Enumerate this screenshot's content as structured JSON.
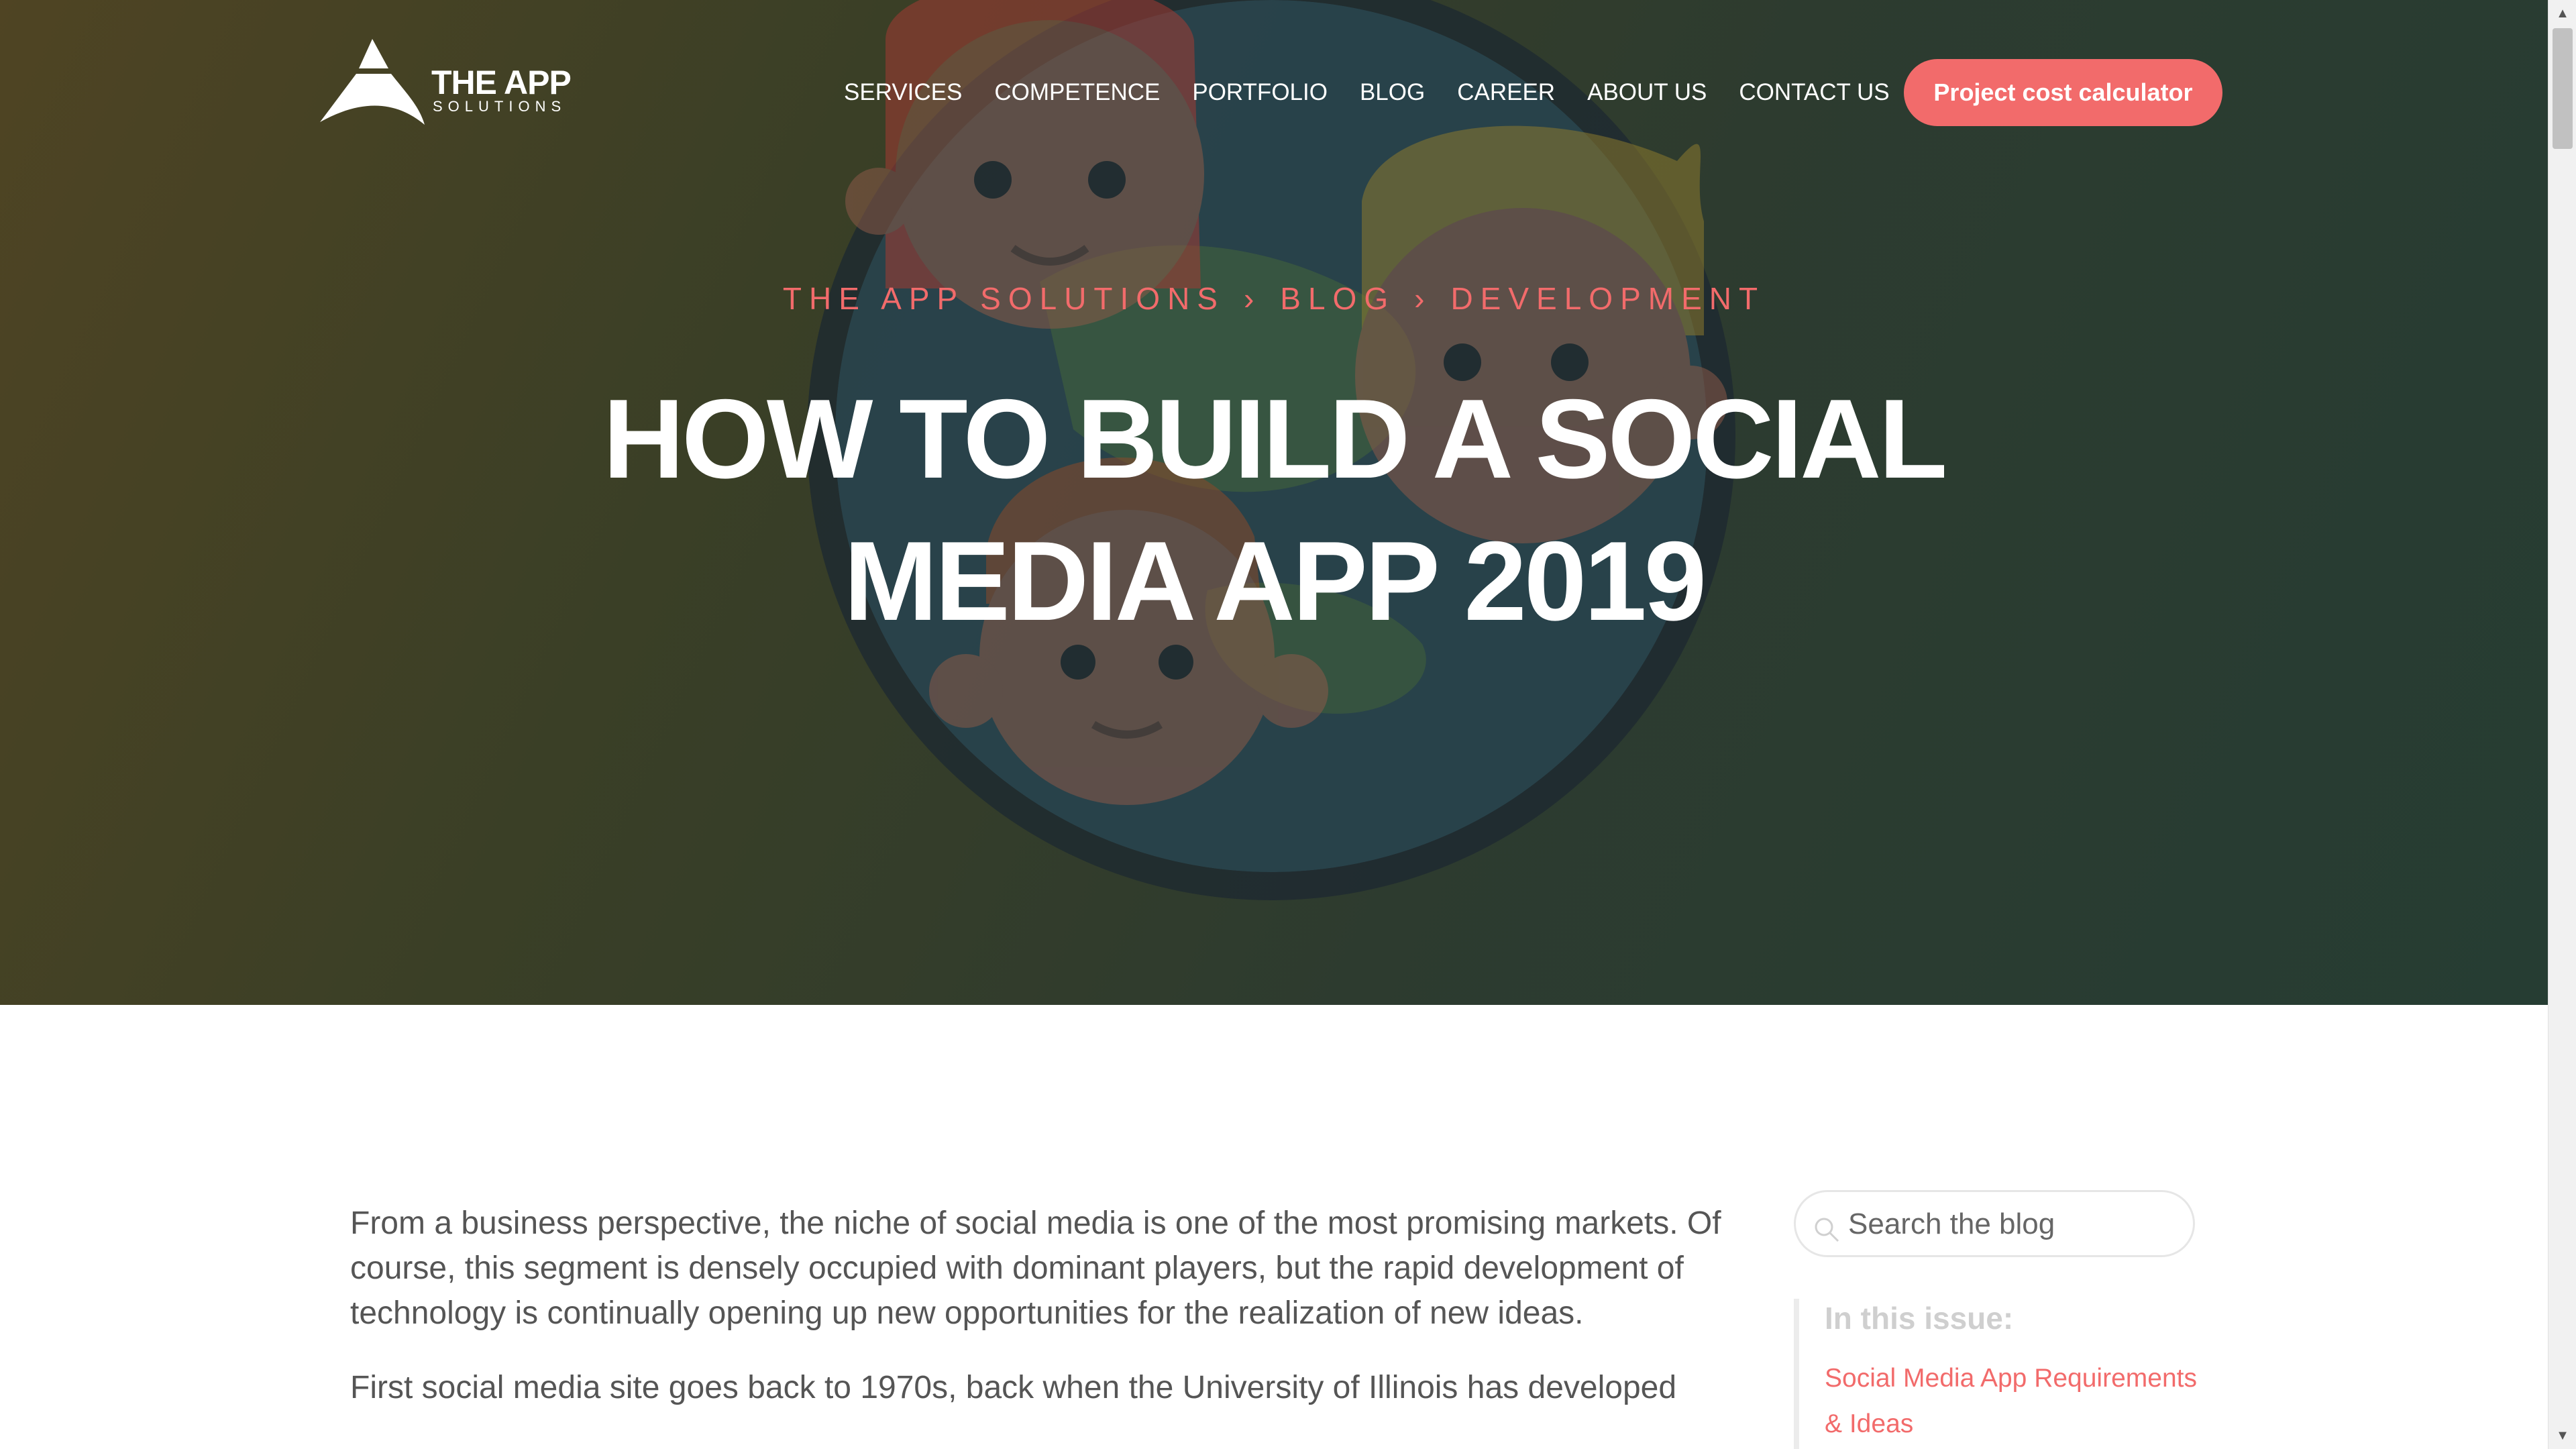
{
  "brand": {
    "name": "THE APP",
    "tagline": "SOLUTIONS"
  },
  "nav": {
    "items": [
      "SERVICES",
      "COMPETENCE",
      "PORTFOLIO",
      "BLOG",
      "CAREER",
      "ABOUT US",
      "CONTACT US"
    ],
    "cta_label": "Project cost calculator"
  },
  "breadcrumb": {
    "home": "THE APP SOLUTIONS",
    "sep": "›",
    "section": "BLOG",
    "category": "DEVELOPMENT"
  },
  "hero": {
    "title_line1": "HOW TO BUILD A SOCIAL",
    "title_line2": "MEDIA APP 2019"
  },
  "article": {
    "paragraph1": "From a business perspective, the niche of social media is one of the most promising markets. Of course, this segment is densely occupied with dominant players, but the rapid development of technology is continually opening up new opportunities for the realization of new ideas.",
    "paragraph2": "First social media site goes back to 1970s, back when the University of Illinois has developed"
  },
  "sidebar": {
    "search_placeholder": "Search the blog",
    "toc_heading": "In this issue:",
    "toc_items": [
      "Social Media App Requirements & Ideas"
    ]
  },
  "colors": {
    "accent": "#f26b6b",
    "hero_overlay": "#2d3b2f",
    "text": "#555555"
  },
  "icons": [
    "logo-mark",
    "search-icon",
    "scroll-up-arrow",
    "scroll-down-arrow"
  ]
}
